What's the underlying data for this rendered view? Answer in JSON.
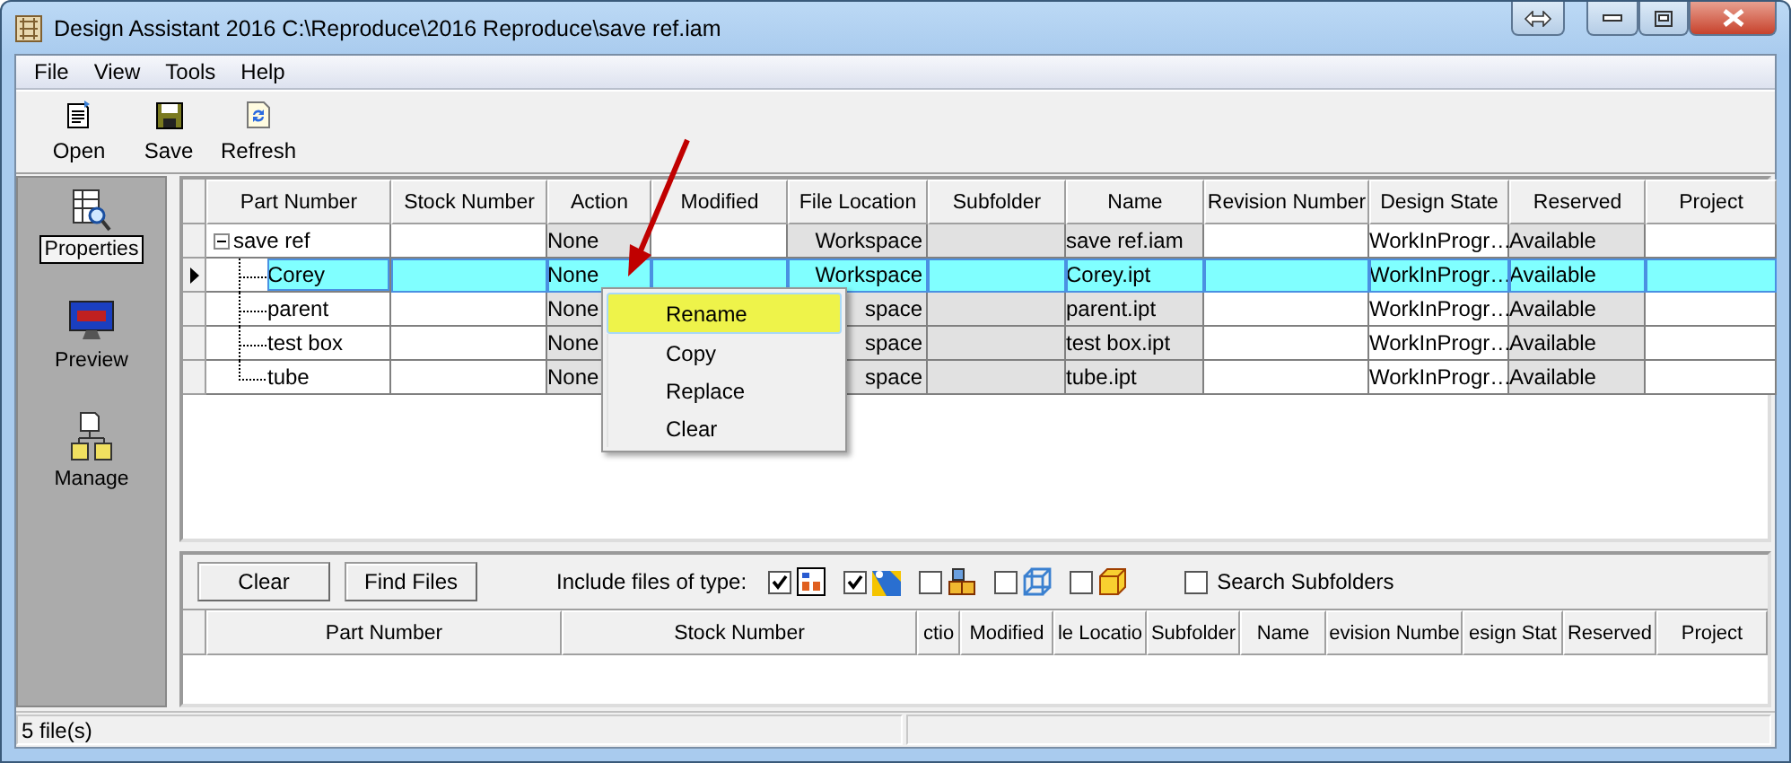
{
  "window": {
    "title": "Design Assistant 2016 C:\\Reproduce\\2016 Reproduce\\save ref.iam"
  },
  "menu": [
    "File",
    "View",
    "Tools",
    "Help"
  ],
  "toolbar": [
    {
      "label": "Open",
      "kind": "open"
    },
    {
      "label": "Save",
      "kind": "save"
    },
    {
      "label": "Refresh",
      "kind": "refresh"
    }
  ],
  "sidebar": {
    "items": [
      {
        "label": "Properties",
        "kind": "properties",
        "selected": true
      },
      {
        "label": "Preview",
        "kind": "preview",
        "selected": false
      },
      {
        "label": "Manage",
        "kind": "manage",
        "selected": false
      }
    ]
  },
  "top_grid": {
    "columns": [
      "Part Number",
      "Stock Number",
      "Action",
      "Modified",
      "File Location",
      "Subfolder",
      "Name",
      "Revision Number",
      "Design State",
      "Reserved",
      "Project"
    ],
    "rows": [
      {
        "part_number": "save ref",
        "action": "None",
        "file_location": "Workspace",
        "name": "save ref.iam",
        "design_state": "WorkInProgr…",
        "reserved": "Available",
        "selected": false,
        "expanded": true,
        "children": [
          {
            "part_number": "Corey",
            "action": "None",
            "file_location": "Workspace",
            "name": "Corey.ipt",
            "design_state": "WorkInProgr…",
            "reserved": "Available",
            "selected": true
          },
          {
            "part_number": "parent",
            "action": "None",
            "file_location": "space",
            "name": "parent.ipt",
            "design_state": "WorkInProgr…",
            "reserved": "Available",
            "selected": false
          },
          {
            "part_number": "test box",
            "action": "None",
            "file_location": "space",
            "name": "test box.ipt",
            "design_state": "WorkInProgr…",
            "reserved": "Available",
            "selected": false
          },
          {
            "part_number": "tube",
            "action": "None",
            "file_location": "space",
            "name": "tube.ipt",
            "design_state": "WorkInProgr…",
            "reserved": "Available",
            "selected": false
          }
        ]
      }
    ]
  },
  "context_menu": {
    "items": [
      {
        "label": "Rename",
        "selected": true
      },
      {
        "label": "Copy",
        "selected": false
      },
      {
        "label": "Replace",
        "selected": false
      },
      {
        "label": "Clear",
        "selected": false
      }
    ]
  },
  "bottom_panel": {
    "buttons": [
      "Clear",
      "Find Files"
    ],
    "include_label": "Include files of type:",
    "file_types": [
      {
        "kind": "assembly",
        "checked": true
      },
      {
        "kind": "drawing",
        "checked": true
      },
      {
        "kind": "parts",
        "checked": false
      },
      {
        "kind": "wireframe",
        "checked": false
      },
      {
        "kind": "part",
        "checked": false
      }
    ],
    "search_subfolders": {
      "label": "Search Subfolders",
      "checked": false
    },
    "grid": {
      "columns": [
        "Part Number",
        "Stock Number",
        "ctio",
        "Modified",
        "le Locatio",
        "Subfolder",
        "Name",
        "evision Numbe",
        "esign Stat",
        "Reserved",
        "Project"
      ]
    }
  },
  "status_bar": {
    "text": "5 file(s)"
  }
}
